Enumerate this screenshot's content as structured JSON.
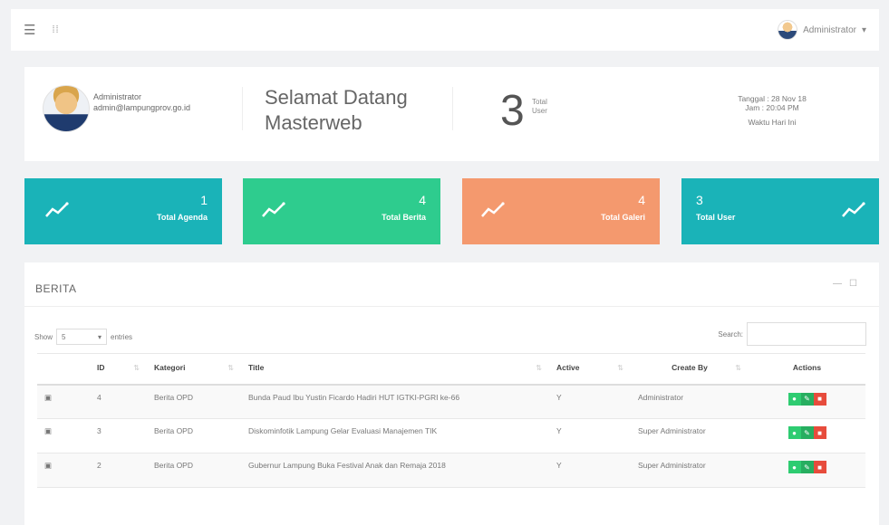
{
  "topbar": {
    "menu_icon": "hamburger-icon",
    "grid_icon": "grid-icon",
    "user_label": "Administrator",
    "caret": "▾"
  },
  "welcome": {
    "name": "Administrator",
    "email": "admin@lampungprov.go.id",
    "greeting_line1": "Selamat Datang",
    "greeting_line2": "Masterweb",
    "total_user_value": "3",
    "total_user_label1": "Total",
    "total_user_label2": "User",
    "date_line": "Tanggal : 28 Nov 18",
    "time_line": "Jam : 20:04 PM",
    "time_caption": "Waktu Hari Ini"
  },
  "stats": [
    {
      "value": "1",
      "label": "Total Agenda",
      "color": "#1ab3b8"
    },
    {
      "value": "4",
      "label": "Total Berita",
      "color": "#2ecc8e"
    },
    {
      "value": "4",
      "label": "Total Galeri",
      "color": "#f4996e"
    },
    {
      "value": "3",
      "label": "Total User",
      "color": "#1ab3b8"
    }
  ],
  "panel": {
    "title": "BERITA",
    "show_label": "Show",
    "show_value": "5",
    "entries_label": "entries",
    "search_label": "Search:",
    "columns": [
      "",
      "ID",
      "Kategori",
      "Title",
      "Active",
      "Create By",
      "Actions"
    ],
    "rows": [
      {
        "id": "4",
        "kategori": "Berita OPD",
        "title": "Bunda Paud Ibu Yustin Ficardo Hadiri HUT IGTKI-PGRI ke-66",
        "active": "Y",
        "create_by": "Administrator"
      },
      {
        "id": "3",
        "kategori": "Berita OPD",
        "title": "Diskominfotik Lampung Gelar Evaluasi Manajemen TIK",
        "active": "Y",
        "create_by": "Super Administrator"
      },
      {
        "id": "2",
        "kategori": "Berita OPD",
        "title": "Gubernur Lampung Buka Festival Anak dan Remaja 2018",
        "active": "Y",
        "create_by": "Super Administrator"
      }
    ]
  }
}
